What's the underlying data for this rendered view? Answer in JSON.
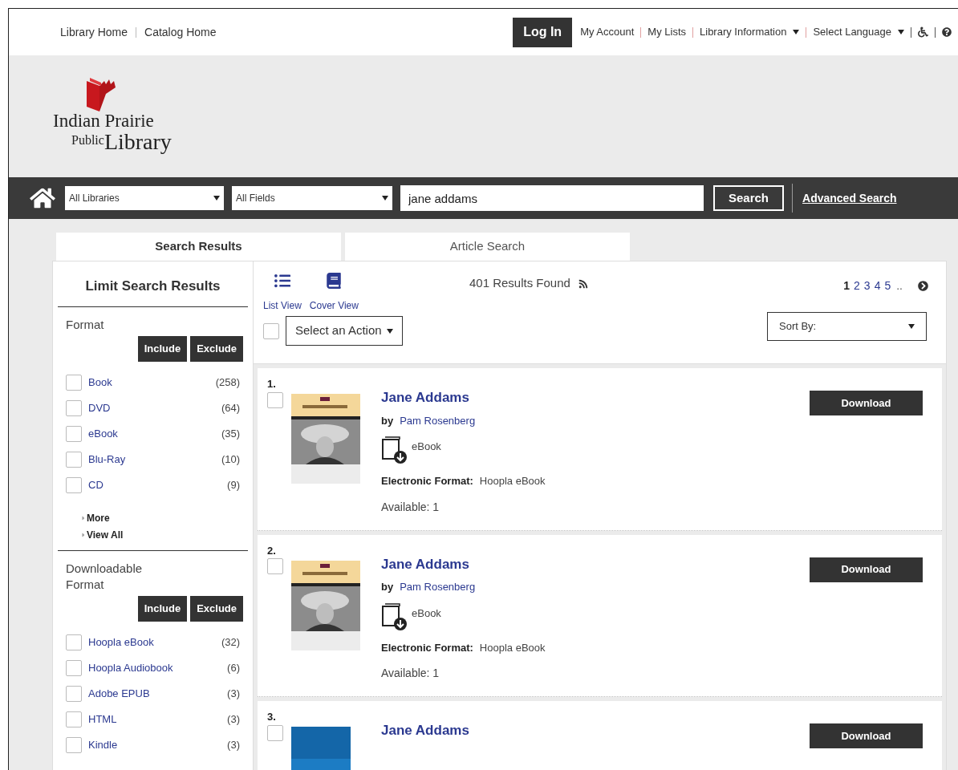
{
  "top_nav": {
    "left_links": [
      "Library Home",
      "Catalog Home"
    ],
    "login": "Log In",
    "right_links": [
      {
        "label": "My Account",
        "dropdown": false
      },
      {
        "label": "My Lists",
        "dropdown": false
      },
      {
        "label": "Library Information",
        "dropdown": true
      },
      {
        "label": "Select Language",
        "dropdown": true
      }
    ]
  },
  "logo": {
    "line1": "Indian Prairie",
    "line2a": "Public",
    "line2b": "Library"
  },
  "search_bar": {
    "library_select": "All Libraries",
    "field_select": "All Fields",
    "query": "jane addams",
    "search_button": "Search",
    "advanced_link": "Advanced Search"
  },
  "tabs": [
    {
      "label": "Search Results",
      "selected": true
    },
    {
      "label": "Article Search",
      "selected": false
    }
  ],
  "sidebar": {
    "title": "Limit Search Results",
    "facets": [
      {
        "title": "Format",
        "include": "Include",
        "exclude": "Exclude",
        "items": [
          {
            "label": "Book",
            "count": "(258)",
            "checked": false
          },
          {
            "label": "DVD",
            "count": "(64)",
            "checked": false
          },
          {
            "label": "eBook",
            "count": "(35)",
            "checked": false
          },
          {
            "label": "Blu-Ray",
            "count": "(10)",
            "checked": false
          },
          {
            "label": "CD",
            "count": "(9)",
            "checked": false
          }
        ],
        "links": [
          "More",
          "View All"
        ]
      },
      {
        "title": "Downloadable Format",
        "include": "Include",
        "exclude": "Exclude",
        "items": [
          {
            "label": "Hoopla eBook",
            "count": "(32)",
            "checked": false
          },
          {
            "label": "Hoopla Audiobook",
            "count": "(6)",
            "checked": false
          },
          {
            "label": "Adobe EPUB",
            "count": "(3)",
            "checked": false
          },
          {
            "label": "HTML",
            "count": "(3)",
            "checked": false
          },
          {
            "label": "Kindle",
            "count": "(3)",
            "checked": false
          }
        ]
      }
    ]
  },
  "results_header": {
    "views": [
      {
        "label": "List View",
        "kind": "list"
      },
      {
        "label": "Cover View",
        "kind": "cover"
      }
    ],
    "count": "401 Results Found",
    "pages": [
      {
        "label": "1",
        "selected": true
      },
      {
        "label": "2",
        "selected": false
      },
      {
        "label": "3",
        "selected": false
      },
      {
        "label": "4",
        "selected": false
      },
      {
        "label": "5",
        "selected": false
      }
    ],
    "ellipsis": "..",
    "select_all_checked": false,
    "action": "Select an Action",
    "sort": "Sort By:"
  },
  "results": [
    {
      "number": "1.",
      "checked": false,
      "cover": {
        "kind": "portrait"
      },
      "title": "Jane Addams",
      "by": "by",
      "author": "Pam Rosenberg",
      "type": "eBook",
      "format_label": "Electronic Format:",
      "format_value": "Hoopla eBook",
      "availability": "Available: 1",
      "button": "Download"
    },
    {
      "number": "2.",
      "checked": false,
      "cover": {
        "kind": "portrait"
      },
      "title": "Jane Addams",
      "by": "by",
      "author": "Pam Rosenberg",
      "type": "eBook",
      "format_label": "Electronic Format:",
      "format_value": "Hoopla eBook",
      "availability": "Available: 1",
      "button": "Download"
    },
    {
      "number": "3.",
      "checked": false,
      "cover": {
        "kind": "blue"
      },
      "title": "Jane Addams",
      "button": "Download"
    }
  ]
}
